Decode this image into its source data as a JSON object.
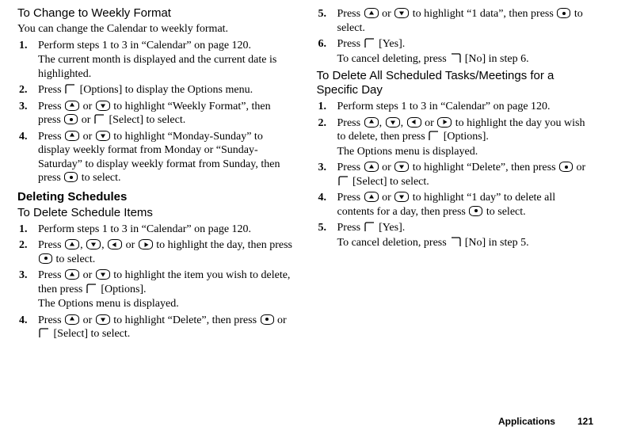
{
  "left": {
    "head_weekly": "To Change to Weekly Format",
    "weekly_intro": "You can change the Calendar to weekly format.",
    "weekly_steps": [
      {
        "main": "Perform steps 1 to 3 in “Calendar” on page 120.",
        "body1": "The current month is displayed and the current date is highlighted."
      },
      {
        "main_a": "Press ",
        "main_b": " [Options] to display the Options menu."
      },
      {
        "main_a": "Press ",
        "main_b": " or ",
        "main_c": " to highlight “Weekly Format”, then press ",
        "main_d": " or ",
        "main_e": " [Select] to select."
      },
      {
        "main_a": "Press ",
        "main_b": " or ",
        "main_c": " to highlight “Monday-Sunday” to display weekly format from Monday or “Sunday-Saturday” to display weekly format from Sunday, then press ",
        "main_d": " to select."
      }
    ],
    "head_deleting": "Deleting Schedules",
    "head_delete_items": "To Delete Schedule Items",
    "delete_items_steps": [
      {
        "main": "Perform steps 1 to 3 in “Calendar” on page 120."
      },
      {
        "main_a": "Press ",
        "main_b": ", ",
        "main_c": ", ",
        "main_d": " or ",
        "main_e": " to highlight the day, then press ",
        "main_f": " to select."
      },
      {
        "main_a": "Press ",
        "main_b": " or ",
        "main_c": " to highlight the item you wish to delete, then press ",
        "main_d": " [Options].",
        "body1": "The Options menu is displayed."
      },
      {
        "main_a": "Press ",
        "main_b": " or ",
        "main_c": " to highlight “Delete”, then press ",
        "main_d": " or ",
        "main_e": " [Select] to select."
      }
    ]
  },
  "right": {
    "cont_steps": [
      {
        "main_a": "Press ",
        "main_b": " or ",
        "main_c": " to highlight “1 data”, then press ",
        "main_d": " to select."
      },
      {
        "main_a": "Press ",
        "main_b": " [Yes].",
        "body_a": "To cancel deleting, press ",
        "body_b": " [No] in step 6."
      }
    ],
    "head_delete_all": "To Delete All Scheduled Tasks/Meetings for a Specific Day",
    "delete_all_steps": [
      {
        "main": "Perform steps 1 to 3 in “Calendar” on page 120."
      },
      {
        "main_a": "Press ",
        "main_b": ", ",
        "main_c": ", ",
        "main_d": " or ",
        "main_e": " to highlight the day you wish to delete, then press ",
        "main_f": " [Options].",
        "body1": "The Options menu is displayed."
      },
      {
        "main_a": "Press ",
        "main_b": " or ",
        "main_c": " to highlight “Delete”, then press ",
        "main_d": " or ",
        "main_e": " [Select] to select."
      },
      {
        "main_a": "Press ",
        "main_b": " or ",
        "main_c": " to highlight “1 day” to delete all contents for a day, then press ",
        "main_d": " to select."
      },
      {
        "main_a": "Press ",
        "main_b": " [Yes].",
        "body_a": "To cancel deletion, press ",
        "body_b": " [No] in step 5."
      }
    ]
  },
  "footer": {
    "section": "Applications",
    "page": "121"
  },
  "nums": {
    "n1": "1.",
    "n2": "2.",
    "n3": "3.",
    "n4": "4.",
    "n5": "5.",
    "n6": "6."
  }
}
